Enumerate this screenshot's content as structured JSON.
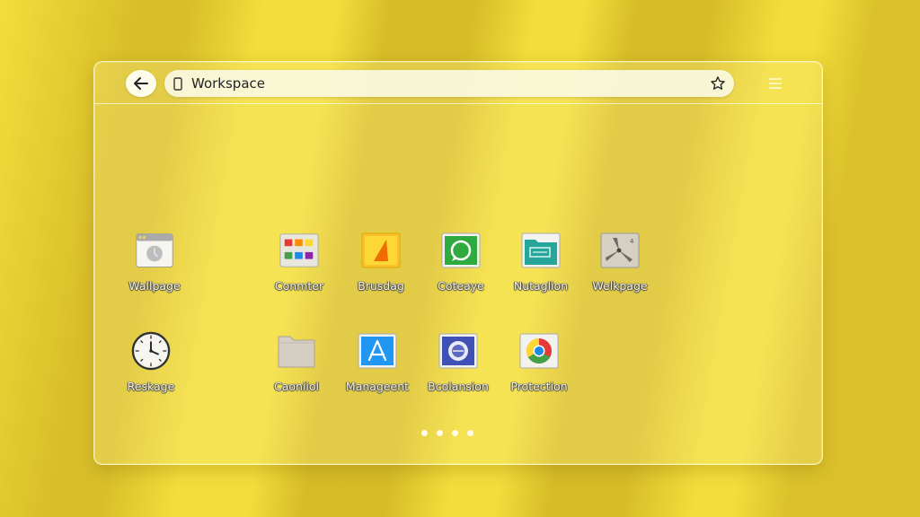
{
  "address_bar": {
    "text": "Workspace"
  },
  "apps": [
    {
      "label": "Wallpage",
      "icon": "browser-window-icon"
    },
    {
      "label": "Conmter",
      "icon": "color-palette-icon"
    },
    {
      "label": "Brusdag",
      "icon": "triangle-doc-icon"
    },
    {
      "label": "Coteaye",
      "icon": "green-chat-icon"
    },
    {
      "label": "Nutaglion",
      "icon": "teal-folder-icon"
    },
    {
      "label": "Welkpage",
      "icon": "pinwheel-icon"
    },
    {
      "label": "Reskage",
      "icon": "clock-icon"
    },
    {
      "label": "Caoniiol",
      "icon": "folder-icon"
    },
    {
      "label": "Manageent",
      "icon": "app-store-icon"
    },
    {
      "label": "Bcolansion",
      "icon": "disc-icon"
    },
    {
      "label": "Protection",
      "icon": "chrome-icon"
    }
  ],
  "pagination": {
    "count": 4
  },
  "colors": {
    "background": "#f3dd3a",
    "glass": "#fff596",
    "label_text": "#f4f1e0"
  }
}
